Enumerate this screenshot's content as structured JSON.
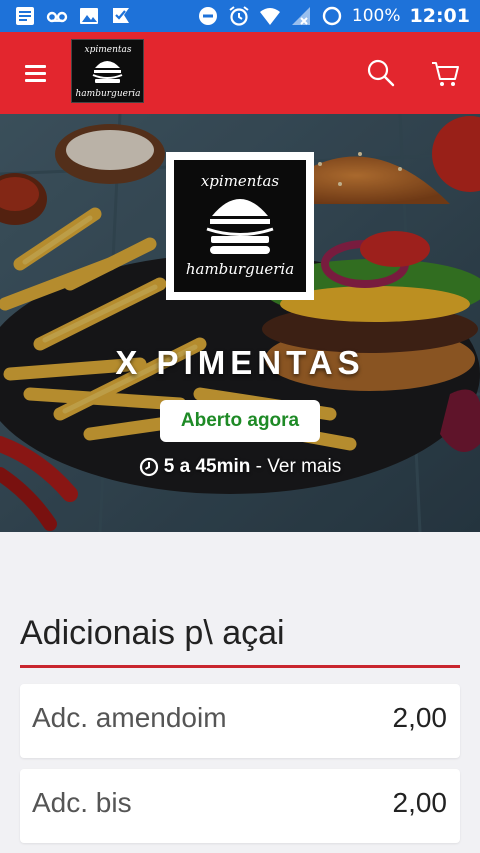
{
  "status_bar": {
    "left_icons": [
      "document-icon",
      "voicemail-icon",
      "image-icon",
      "check-flag-icon"
    ],
    "right_icons": [
      "do-not-disturb-icon",
      "alarm-icon",
      "wifi-icon",
      "signal-icon",
      "battery-icon"
    ],
    "battery": "100%",
    "time": "12:01"
  },
  "toolbar": {
    "menu_icon": "menu-icon",
    "logo_top_text": "xpimentas",
    "logo_bottom_text": "hamburgueria",
    "search_icon": "search-icon",
    "cart_icon": "cart-icon",
    "background": "#e3262e"
  },
  "hero": {
    "logo_top_text": "xpimentas",
    "logo_bottom_text": "hamburgueria",
    "store_name": "X PIMENTAS",
    "status_badge": "Aberto agora",
    "status_color": "#1e8a26",
    "clock_icon": "clock-icon",
    "delivery_time": "5 a 45min",
    "separator": " - ",
    "see_more": "Ver mais"
  },
  "menu": {
    "section_title": "Adicionais p\\ açai",
    "accent": "#c9262e",
    "items": [
      {
        "name": "Adc. amendoim",
        "price": "2,00"
      },
      {
        "name": "Adc. bis",
        "price": "2,00"
      }
    ]
  }
}
